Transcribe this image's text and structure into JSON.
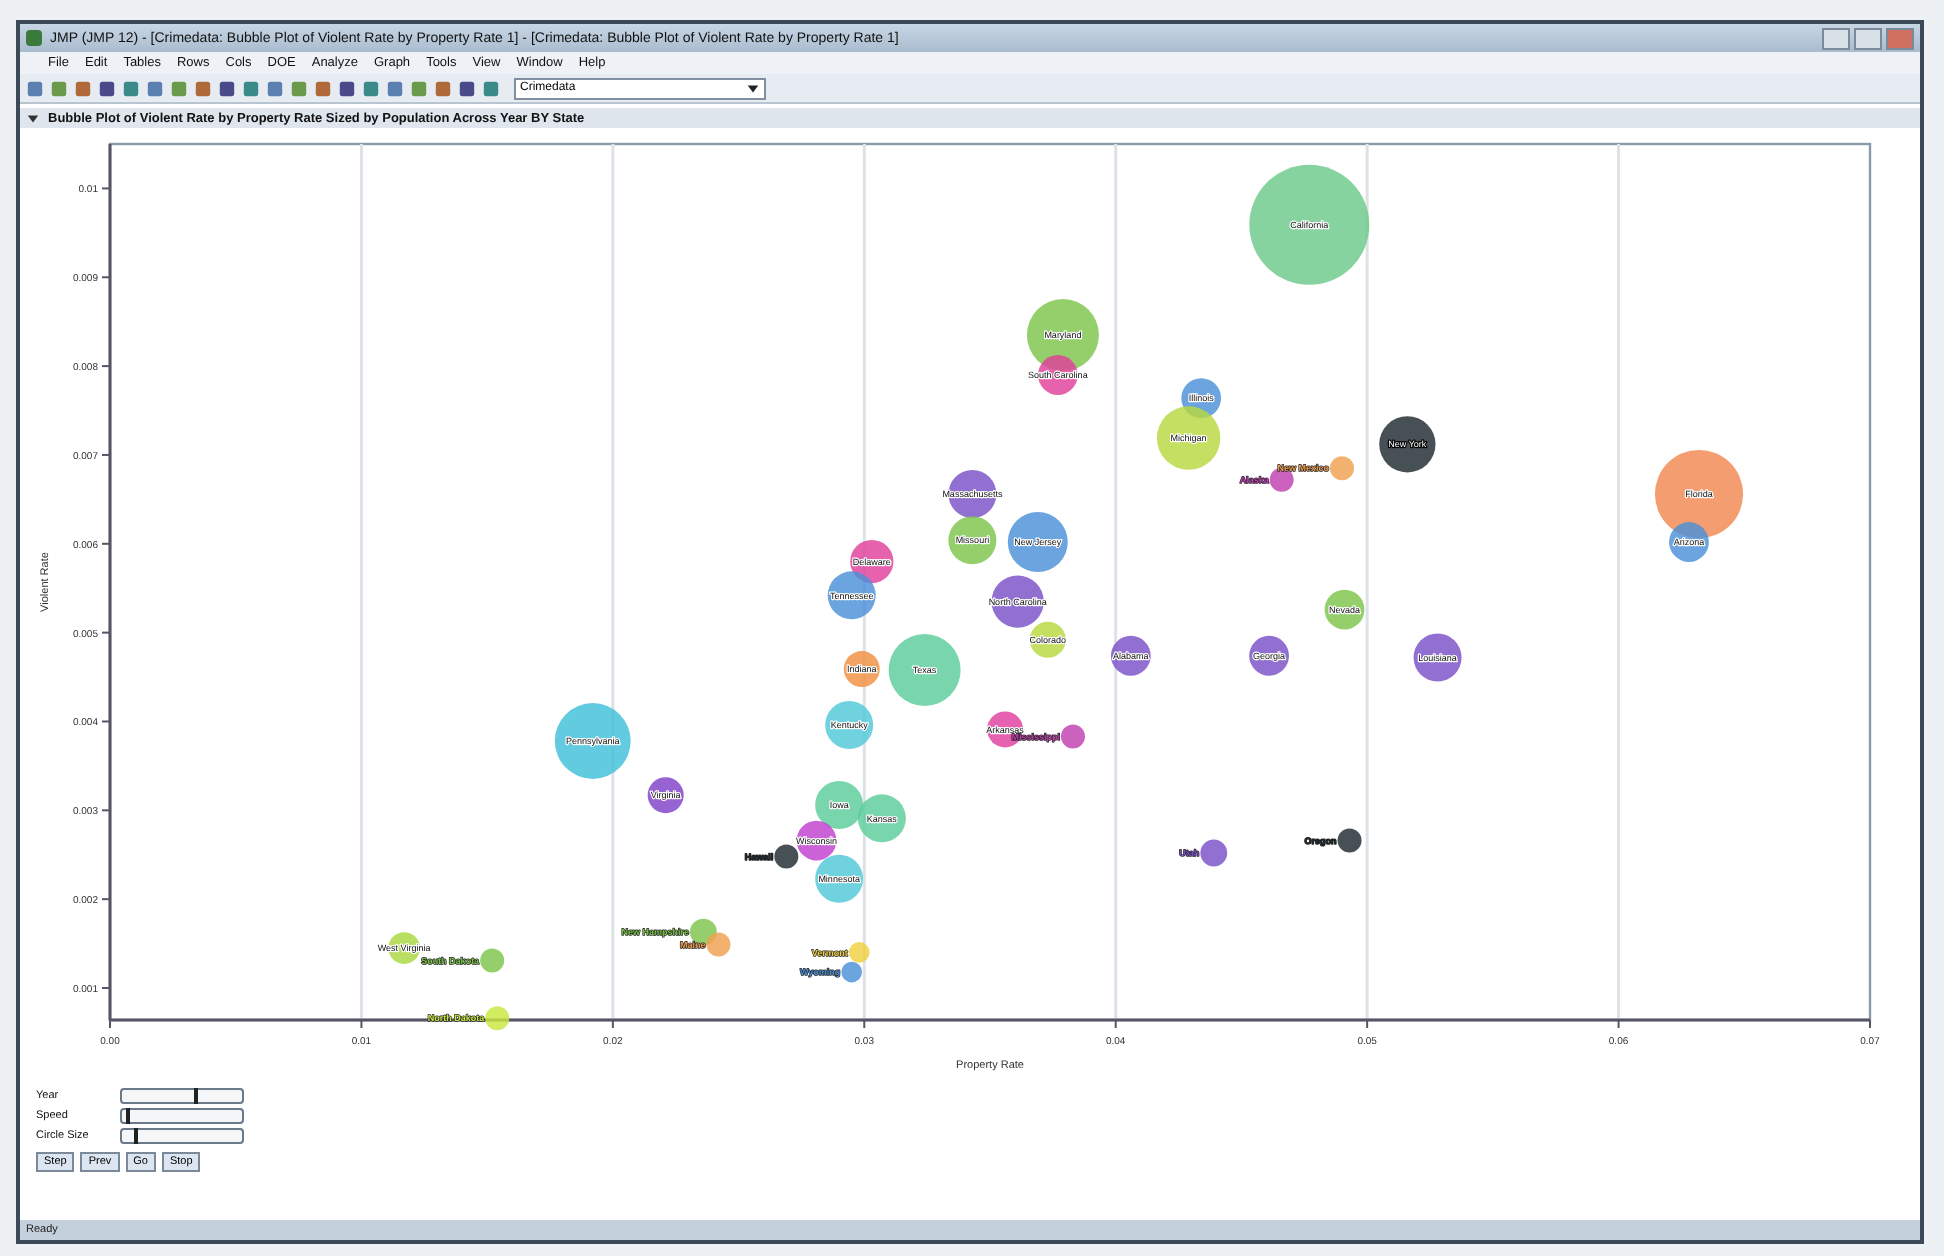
{
  "window": {
    "title": "JMP (JMP 12) - [Crimedata: Bubble Plot of Violent Rate by Property Rate 1] - [Crimedata: Bubble Plot of Violent Rate by Property Rate 1]"
  },
  "menu": [
    "File",
    "Edit",
    "Tables",
    "Rows",
    "Cols",
    "DOE",
    "Analyze",
    "Graph",
    "Tools",
    "View",
    "Window",
    "Help"
  ],
  "toolbar": {
    "table_select": "Crimedata"
  },
  "report": {
    "title": "Bubble Plot of Violent Rate by Property Rate Sized by Population Across Year BY State",
    "expanded": true,
    "chart_data": {
      "type": "scatter",
      "xlabel": "Property Rate",
      "ylabel": "Violent Rate",
      "grid": true,
      "xlim": [
        0,
        0.07
      ],
      "ylim": [
        0.00064,
        0.0105
      ],
      "xticks": [
        {
          "value": 0,
          "label": "0.00"
        },
        {
          "value": 0.01,
          "label": "0.01"
        },
        {
          "value": 0.02,
          "label": "0.02"
        },
        {
          "value": 0.03,
          "label": "0.03"
        },
        {
          "value": 0.04,
          "label": "0.04"
        },
        {
          "value": 0.05,
          "label": "0.05"
        },
        {
          "value": 0.06,
          "label": "0.06"
        },
        {
          "value": 0.07,
          "label": "0.07"
        }
      ],
      "yticks": [
        {
          "value": 0.001,
          "label": "0.001"
        },
        {
          "value": 0.002,
          "label": "0.002"
        },
        {
          "value": 0.003,
          "label": "0.003"
        },
        {
          "value": 0.004,
          "label": "0.004"
        },
        {
          "value": 0.005,
          "label": "0.005"
        },
        {
          "value": 0.006,
          "label": "0.006"
        },
        {
          "value": 0.007,
          "label": "0.007"
        },
        {
          "value": 0.008,
          "label": "0.008"
        },
        {
          "value": 0.009,
          "label": "0.009"
        },
        {
          "value": 0.01,
          "label": "0.01"
        }
      ],
      "series": [
        {
          "name": "California",
          "color": "#6cc98a",
          "x": [
            0.0477
          ],
          "values": [
            0.00959
          ],
          "sizes": [
            1
          ]
        },
        {
          "name": "Maryland",
          "color": "#7cc44a",
          "x": [
            0.0379
          ],
          "values": [
            0.00835
          ],
          "sizes": [
            0.36
          ]
        },
        {
          "name": "South Carolina",
          "color": "#e0409a",
          "x": [
            0.0377
          ],
          "values": [
            0.0079
          ],
          "sizes": [
            0.11
          ]
        },
        {
          "name": "Illinois",
          "color": "#4a90d8",
          "x": [
            0.0434
          ],
          "values": [
            0.00764
          ],
          "sizes": [
            0.11
          ]
        },
        {
          "name": "Michigan",
          "color": "#b8d840",
          "x": [
            0.0429
          ],
          "values": [
            0.00719
          ],
          "sizes": [
            0.28
          ]
        },
        {
          "name": "New York",
          "color": "#1f2a30",
          "x": [
            0.0516
          ],
          "values": [
            0.00712
          ],
          "sizes": [
            0.22
          ]
        },
        {
          "name": "New Mexico",
          "color": "#f0a050",
          "x": [
            0.049
          ],
          "values": [
            0.00685
          ],
          "sizes": [
            0.04
          ]
        },
        {
          "name": "Alaska",
          "color": "#c040b0",
          "x": [
            0.0466
          ],
          "values": [
            0.00672
          ],
          "sizes": [
            0.04
          ]
        },
        {
          "name": "Florida",
          "color": "#f08850",
          "x": [
            0.0632
          ],
          "values": [
            0.00656
          ],
          "sizes": [
            0.54
          ]
        },
        {
          "name": "Arizona",
          "color": "#4a90d8",
          "x": [
            0.0628
          ],
          "values": [
            0.00602
          ],
          "sizes": [
            0.11
          ]
        },
        {
          "name": "Massachusetts",
          "color": "#7a50c8",
          "x": [
            0.0343
          ],
          "values": [
            0.00656
          ],
          "sizes": [
            0.16
          ]
        },
        {
          "name": "Missouri",
          "color": "#7cc44a",
          "x": [
            0.0343
          ],
          "values": [
            0.00604
          ],
          "sizes": [
            0.16
          ]
        },
        {
          "name": "New Jersey",
          "color": "#4a90d8",
          "x": [
            0.0369
          ],
          "values": [
            0.00602
          ],
          "sizes": [
            0.25
          ]
        },
        {
          "name": "Delaware",
          "color": "#e0409a",
          "x": [
            0.0303
          ],
          "values": [
            0.0058
          ],
          "sizes": [
            0.13
          ]
        },
        {
          "name": "Tennessee",
          "color": "#4a90d8",
          "x": [
            0.0295
          ],
          "values": [
            0.00542
          ],
          "sizes": [
            0.16
          ]
        },
        {
          "name": "North Carolina",
          "color": "#7a50c8",
          "x": [
            0.0361
          ],
          "values": [
            0.00535
          ],
          "sizes": [
            0.19
          ]
        },
        {
          "name": "Colorado",
          "color": "#b8d840",
          "x": [
            0.0373
          ],
          "values": [
            0.00492
          ],
          "sizes": [
            0.09
          ]
        },
        {
          "name": "Nevada",
          "color": "#7cc44a",
          "x": [
            0.0491
          ],
          "values": [
            0.00526
          ],
          "sizes": [
            0.11
          ]
        },
        {
          "name": "Alabama",
          "color": "#7a50c8",
          "x": [
            0.0406
          ],
          "values": [
            0.00474
          ],
          "sizes": [
            0.11
          ]
        },
        {
          "name": "Georgia",
          "color": "#7a50c8",
          "x": [
            0.0461
          ],
          "values": [
            0.00474
          ],
          "sizes": [
            0.11
          ]
        },
        {
          "name": "Louisiana",
          "color": "#7a50c8",
          "x": [
            0.0528
          ],
          "values": [
            0.00472
          ],
          "sizes": [
            0.16
          ]
        },
        {
          "name": "Texas",
          "color": "#5ccc9a",
          "x": [
            0.0324
          ],
          "values": [
            0.00458
          ],
          "sizes": [
            0.36
          ]
        },
        {
          "name": "Indiana",
          "color": "#f09040",
          "x": [
            0.0299
          ],
          "values": [
            0.00459
          ],
          "sizes": [
            0.09
          ]
        },
        {
          "name": "Kentucky",
          "color": "#50c8d8",
          "x": [
            0.0294
          ],
          "values": [
            0.00396
          ],
          "sizes": [
            0.16
          ]
        },
        {
          "name": "Pennsylvania",
          "color": "#40c0d8",
          "x": [
            0.0192
          ],
          "values": [
            0.00378
          ],
          "sizes": [
            0.4
          ]
        },
        {
          "name": "Arkansas",
          "color": "#e040a0",
          "x": [
            0.0356
          ],
          "values": [
            0.00391
          ],
          "sizes": [
            0.09
          ]
        },
        {
          "name": "Mississippi",
          "color": "#c040b0",
          "x": [
            0.0383
          ],
          "values": [
            0.00383
          ],
          "sizes": [
            0.04
          ]
        },
        {
          "name": "Virginia",
          "color": "#8040c8",
          "x": [
            0.0221
          ],
          "values": [
            0.00317
          ],
          "sizes": [
            0.09
          ]
        },
        {
          "name": "Iowa",
          "color": "#5ccc9a",
          "x": [
            0.029
          ],
          "values": [
            0.00306
          ],
          "sizes": [
            0.16
          ]
        },
        {
          "name": "Kansas",
          "color": "#5ccc9a",
          "x": [
            0.0307
          ],
          "values": [
            0.00291
          ],
          "sizes": [
            0.16
          ]
        },
        {
          "name": "Wisconsin",
          "color": "#c040d0",
          "x": [
            0.0281
          ],
          "values": [
            0.00266
          ],
          "sizes": [
            0.11
          ]
        },
        {
          "name": "Hawaii",
          "color": "#1f2a30",
          "x": [
            0.0269
          ],
          "values": [
            0.00248
          ],
          "sizes": [
            0.04
          ]
        },
        {
          "name": "Minnesota",
          "color": "#50c8d8",
          "x": [
            0.029
          ],
          "values": [
            0.00223
          ],
          "sizes": [
            0.16
          ]
        },
        {
          "name": "Utah",
          "color": "#7a50c8",
          "x": [
            0.0439
          ],
          "values": [
            0.00252
          ],
          "sizes": [
            0.05
          ]
        },
        {
          "name": "Oregon",
          "color": "#1f2a30",
          "x": [
            0.0493
          ],
          "values": [
            0.00266
          ],
          "sizes": [
            0.04
          ]
        },
        {
          "name": "New Hampshire",
          "color": "#7cc44a",
          "x": [
            0.0236
          ],
          "values": [
            0.00163
          ],
          "sizes": [
            0.05
          ]
        },
        {
          "name": "Maine",
          "color": "#f0a050",
          "x": [
            0.0242
          ],
          "values": [
            0.00149
          ],
          "sizes": [
            0.04
          ]
        },
        {
          "name": "West Virginia",
          "color": "#a8d840",
          "x": [
            0.0117
          ],
          "values": [
            0.00145
          ],
          "sizes": [
            0.07
          ]
        },
        {
          "name": "South Dakota",
          "color": "#7cc44a",
          "x": [
            0.0152
          ],
          "values": [
            0.00131
          ],
          "sizes": [
            0.04
          ]
        },
        {
          "name": "North Dakota",
          "color": "#c8e840",
          "x": [
            0.0154
          ],
          "values": [
            0.00066
          ],
          "sizes": [
            0.04
          ]
        },
        {
          "name": "Vermont",
          "color": "#f0d040",
          "x": [
            0.0298
          ],
          "values": [
            0.0014
          ],
          "sizes": [
            0.03
          ]
        },
        {
          "name": "Wyoming",
          "color": "#4a90d8",
          "x": [
            0.0295
          ],
          "values": [
            0.00118
          ],
          "sizes": [
            0.03
          ]
        }
      ]
    }
  },
  "controls": [
    {
      "label": "Year",
      "level": 0.6
    },
    {
      "label": "Speed",
      "level": 0.04
    },
    {
      "label": "Circle Size",
      "level": 0.1
    }
  ],
  "buttons": [
    "Step",
    "Prev",
    "Go",
    "Stop"
  ],
  "status_bar": {
    "left": "Ready"
  }
}
